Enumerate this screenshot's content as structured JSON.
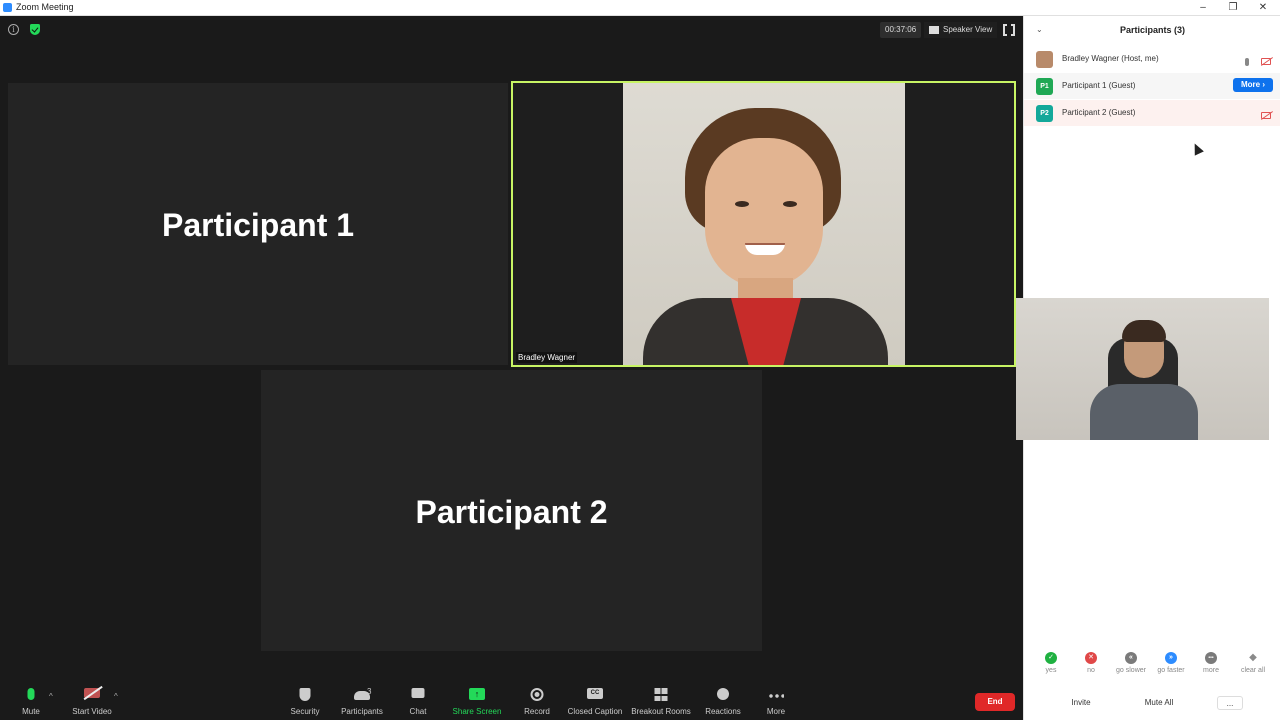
{
  "window": {
    "title": "Zoom Meeting"
  },
  "meeting": {
    "timer": "00:37:06",
    "view_label": "Speaker View",
    "tiles": {
      "p1_name": "Participant 1",
      "p2_name": "Participant 2",
      "active_caption": "Bradley Wagner"
    },
    "active_speaker_border_color": "#c7f464"
  },
  "toolbar": {
    "mute": "Mute",
    "start_video": "Start Video",
    "security": "Security",
    "participants": "Participants",
    "participants_count": "3",
    "chat": "Chat",
    "share_screen": "Share Screen",
    "record": "Record",
    "closed_caption": "Closed Caption",
    "cc_glyph": "CC",
    "breakout_rooms": "Breakout Rooms",
    "reactions": "Reactions",
    "more": "More",
    "end": "End",
    "share_glyph": "↑"
  },
  "panel": {
    "title": "Participants (3)",
    "participants": [
      {
        "name": "Bradley Wagner (Host, me)",
        "avatar": ""
      },
      {
        "name": "Participant 1 (Guest)",
        "avatar": "P1"
      },
      {
        "name": "Participant 2 (Guest)",
        "avatar": "P2"
      }
    ],
    "more_button": "More ›",
    "feedback": [
      {
        "label": "yes",
        "glyph": "✓",
        "color": "#1fb141"
      },
      {
        "label": "no",
        "glyph": "✕",
        "color": "#e04848"
      },
      {
        "label": "go slower",
        "glyph": "«",
        "color": "#7a7a7a"
      },
      {
        "label": "go faster",
        "glyph": "»",
        "color": "#2d8cff"
      },
      {
        "label": "more",
        "glyph": "•••",
        "color": "#7a7a7a"
      },
      {
        "label": "clear all",
        "glyph": "◆",
        "color": "#8a8a8a"
      }
    ],
    "invite": "Invite",
    "mute_all": "Mute All",
    "more_dots": "..."
  },
  "colors": {
    "accent_green": "#23d959",
    "brand_blue": "#0e72ed",
    "end_red": "#e02828",
    "avatar_green": "#1fa855"
  }
}
